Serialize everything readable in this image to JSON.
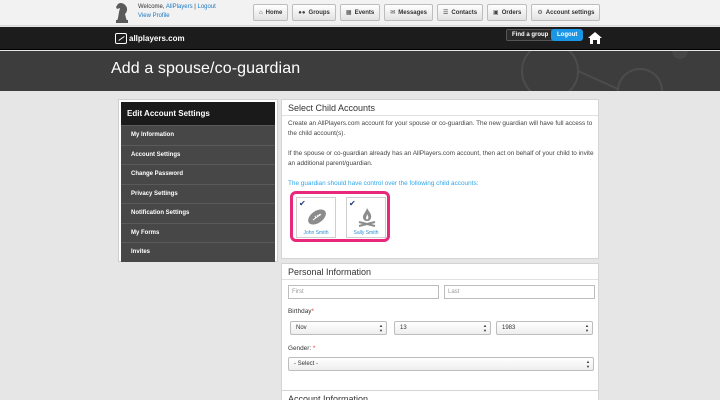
{
  "topbar": {
    "welcome_prefix": "Welcome, ",
    "username": "AllPlayers",
    "separator": " | ",
    "logout_link": "Logout",
    "view_profile": "View Profile",
    "nav": [
      {
        "label": "Home",
        "icon": "home-icon"
      },
      {
        "label": "Groups",
        "icon": "groups-icon"
      },
      {
        "label": "Events",
        "icon": "calendar-icon"
      },
      {
        "label": "Messages",
        "icon": "envelope-icon"
      },
      {
        "label": "Contacts",
        "icon": "contacts-icon"
      },
      {
        "label": "Orders",
        "icon": "cart-icon"
      },
      {
        "label": "Account settings",
        "icon": "gear-icon"
      }
    ]
  },
  "header": {
    "brand": "allplayers.com",
    "find_group": "Find a group",
    "logout": "Logout"
  },
  "page": {
    "title": "Add a spouse/co-guardian"
  },
  "sidebar": {
    "heading": "Edit Account Settings",
    "items": [
      {
        "label": "My Information"
      },
      {
        "label": "Account Settings"
      },
      {
        "label": "Change Password"
      },
      {
        "label": "Privacy Settings"
      },
      {
        "label": "Notification Settings"
      },
      {
        "label": "My Forms"
      },
      {
        "label": "Invites"
      }
    ]
  },
  "select_child": {
    "title": "Select Child Accounts",
    "para1": "Create an AllPlayers.com account for your spouse or co-guardian. The new guardian will have full access to the child account(s).",
    "para2": "If the spouse or co-guardian already has an AllPlayers.com account, then act on behalf of your child to invite an additional parent/guardian.",
    "guardian_note": "The guardian should have control over the following child accounts:",
    "children": [
      {
        "name": "John Smith",
        "checked": true,
        "icon": "football-icon"
      },
      {
        "name": "Sally Smith",
        "checked": true,
        "icon": "campfire-icon"
      }
    ],
    "highlight_color": "#e8297b"
  },
  "personal": {
    "title": "Personal Information",
    "first_placeholder": "First",
    "last_placeholder": "Last",
    "birthday_label": "Birthday",
    "birth_month": "Nov",
    "birth_day": "13",
    "birth_year": "1983",
    "gender_label": "Gender:",
    "gender_value": "- Select -",
    "required_mark": "*"
  },
  "account": {
    "title": "Account Information"
  }
}
